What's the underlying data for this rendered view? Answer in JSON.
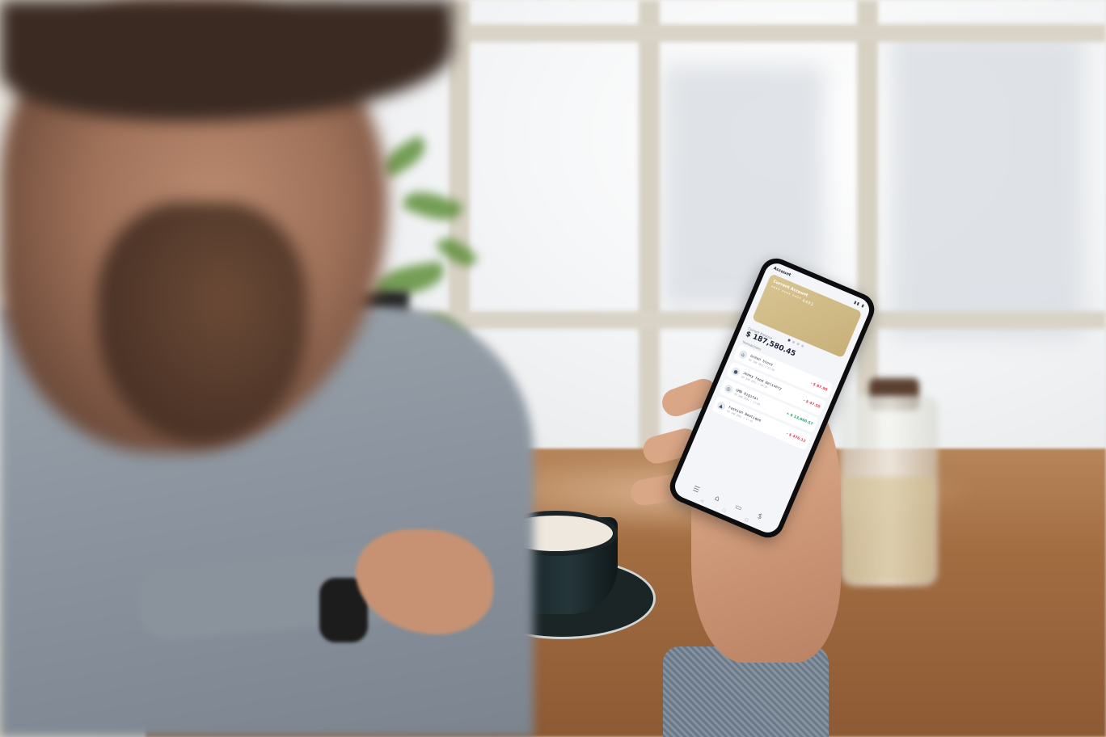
{
  "scene": {
    "subject": "man-holding-phone",
    "icons": [
      "menu-icon",
      "home-icon",
      "cards-icon",
      "payment-icon",
      "back-nav-icon",
      "home-nav-icon",
      "recents-nav-icon"
    ]
  },
  "phone": {
    "status_title": "Account",
    "status_icons": "▮▮ ▮",
    "card": {
      "name": "Current Account",
      "number": "**** **** **** 4493",
      "color": "#cfb985"
    },
    "carousel_dots": 4,
    "balance": {
      "label": "Current Balance",
      "value": "$ 187,580.45"
    },
    "transactions_label": "Transactions",
    "transactions": [
      {
        "name": "Green Store",
        "date": "05 JAN 2021 | 21:28",
        "amount": "- $ 87.90",
        "kind": "negative",
        "icon": "store-icon"
      },
      {
        "name": "Jenny Food Delivery",
        "date": "04 JAN 2021 | 20:35",
        "amount": "- $ 47.50",
        "kind": "negative",
        "icon": "food-icon"
      },
      {
        "name": "GMD Digital",
        "date": "03 JAN 2021 | 11:00",
        "amount": "+ $ 13,660.57",
        "kind": "positive",
        "icon": "digital-icon"
      },
      {
        "name": "Fashion Boutique",
        "date": "02 JAN 2021 | 17:45",
        "amount": "- $ 476.12",
        "kind": "negative",
        "icon": "fashion-icon"
      }
    ],
    "colors": {
      "negative": "#e0405a",
      "positive": "#2aa06a",
      "accent": "#3d4a66"
    }
  }
}
